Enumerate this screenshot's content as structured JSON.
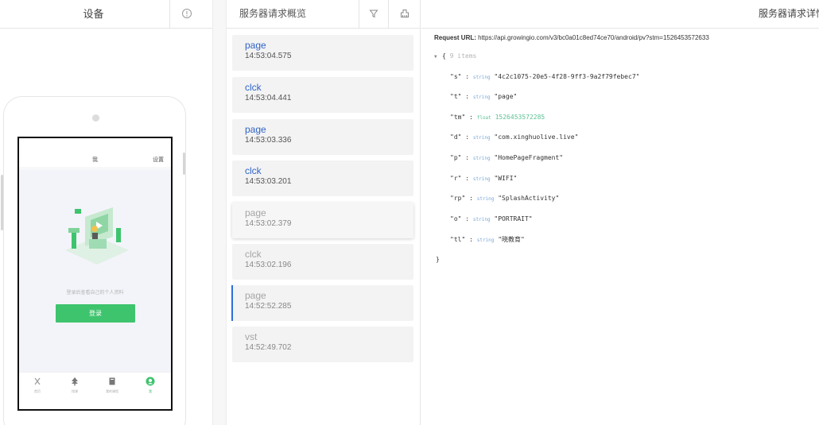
{
  "device": {
    "title": "设备",
    "app": {
      "title": "我",
      "settings": "设置",
      "login_tip": "登录后查看自己的个人资料",
      "login_button": "登录",
      "tabs": [
        {
          "label": "首页",
          "icon": "home-icon"
        },
        {
          "label": "找课",
          "icon": "tree-icon"
        },
        {
          "label": "我的课程",
          "icon": "book-icon"
        },
        {
          "label": "我",
          "icon": "user-icon",
          "active": true
        }
      ]
    }
  },
  "requests": {
    "title": "服务器请求概览",
    "items": [
      {
        "type": "page",
        "time": "14:53:04.575"
      },
      {
        "type": "clck",
        "time": "14:53:04.441"
      },
      {
        "type": "page",
        "time": "14:53:03.336"
      },
      {
        "type": "clck",
        "time": "14:53:03.201"
      },
      {
        "type": "page",
        "time": "14:53:02.379"
      },
      {
        "type": "clck",
        "time": "14:53:02.196"
      },
      {
        "type": "page",
        "time": "14:52:52.285"
      },
      {
        "type": "vst",
        "time": "14:52:49.702"
      }
    ]
  },
  "detail": {
    "title": "服务器请求详情",
    "url_label": "Request URL:",
    "url": "https://api.growingio.com/v3/bc0a01c8ed74ce70/android/pv?stm=1526453572633",
    "item_count": "9 items",
    "fields": [
      {
        "key": "\"s\"",
        "type": "string",
        "value": "\"4c2c1075-20e5-4f28-9ff3-9a2f79febec7\""
      },
      {
        "key": "\"t\"",
        "type": "string",
        "value": "\"page\""
      },
      {
        "key": "\"tm\"",
        "type": "float",
        "value": "1526453572285"
      },
      {
        "key": "\"d\"",
        "type": "string",
        "value": "\"com.xinghuolive.live\""
      },
      {
        "key": "\"p\"",
        "type": "string",
        "value": "\"HomePageFragment\""
      },
      {
        "key": "\"r\"",
        "type": "string",
        "value": "\"WIFI\""
      },
      {
        "key": "\"rp\"",
        "type": "string",
        "value": "\"SplashActivity\""
      },
      {
        "key": "\"o\"",
        "type": "string",
        "value": "\"PORTRAIT\""
      },
      {
        "key": "\"tl\"",
        "type": "string",
        "value": "\"晓教育\""
      }
    ]
  }
}
